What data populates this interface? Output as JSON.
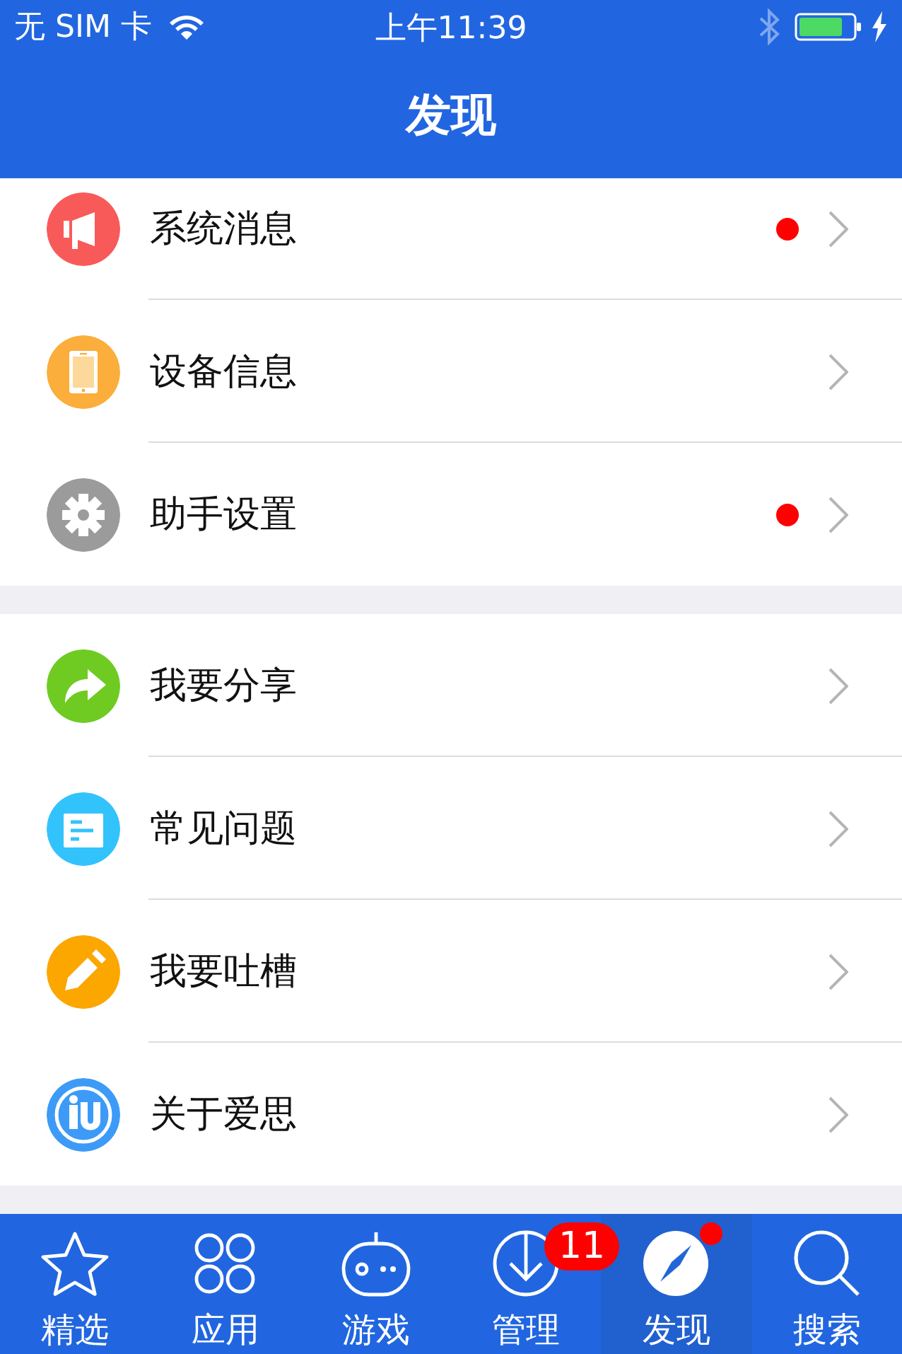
{
  "status_bar": {
    "carrier": "无 SIM 卡",
    "time": "上午11:39",
    "bluetooth_on": false
  },
  "nav_bar": {
    "title": "发现"
  },
  "sections": [
    {
      "items": [
        {
          "label": "系统消息",
          "kind": "megaphone",
          "color": "#f85a5a",
          "unread": true
        },
        {
          "label": "设备信息",
          "kind": "phone",
          "color": "#fbae3b",
          "unread": false
        },
        {
          "label": "助手设置",
          "kind": "gear",
          "color": "#9b9b9b",
          "unread": true
        }
      ]
    },
    {
      "items": [
        {
          "label": "我要分享",
          "kind": "share",
          "color": "#6fcb22",
          "unread": false
        },
        {
          "label": "常见问题",
          "kind": "document",
          "color": "#33c3fc",
          "unread": false
        },
        {
          "label": "我要吐槽",
          "kind": "pencil",
          "color": "#fca600",
          "unread": false
        },
        {
          "label": "关于爱思",
          "kind": "logo",
          "color": "#3d9bf7",
          "unread": false
        }
      ]
    }
  ],
  "tab_bar": [
    {
      "label": "精选",
      "kind": "star",
      "selected": false,
      "dot": false
    },
    {
      "label": "应用",
      "kind": "apps",
      "selected": false,
      "dot": false
    },
    {
      "label": "游戏",
      "kind": "gamepad",
      "selected": false,
      "dot": false
    },
    {
      "label": "管理",
      "kind": "download",
      "selected": false,
      "dot": false,
      "badge": "11"
    },
    {
      "label": "发现",
      "kind": "compass",
      "selected": true,
      "dot": true
    },
    {
      "label": "搜索",
      "kind": "search",
      "selected": false,
      "dot": false
    }
  ]
}
